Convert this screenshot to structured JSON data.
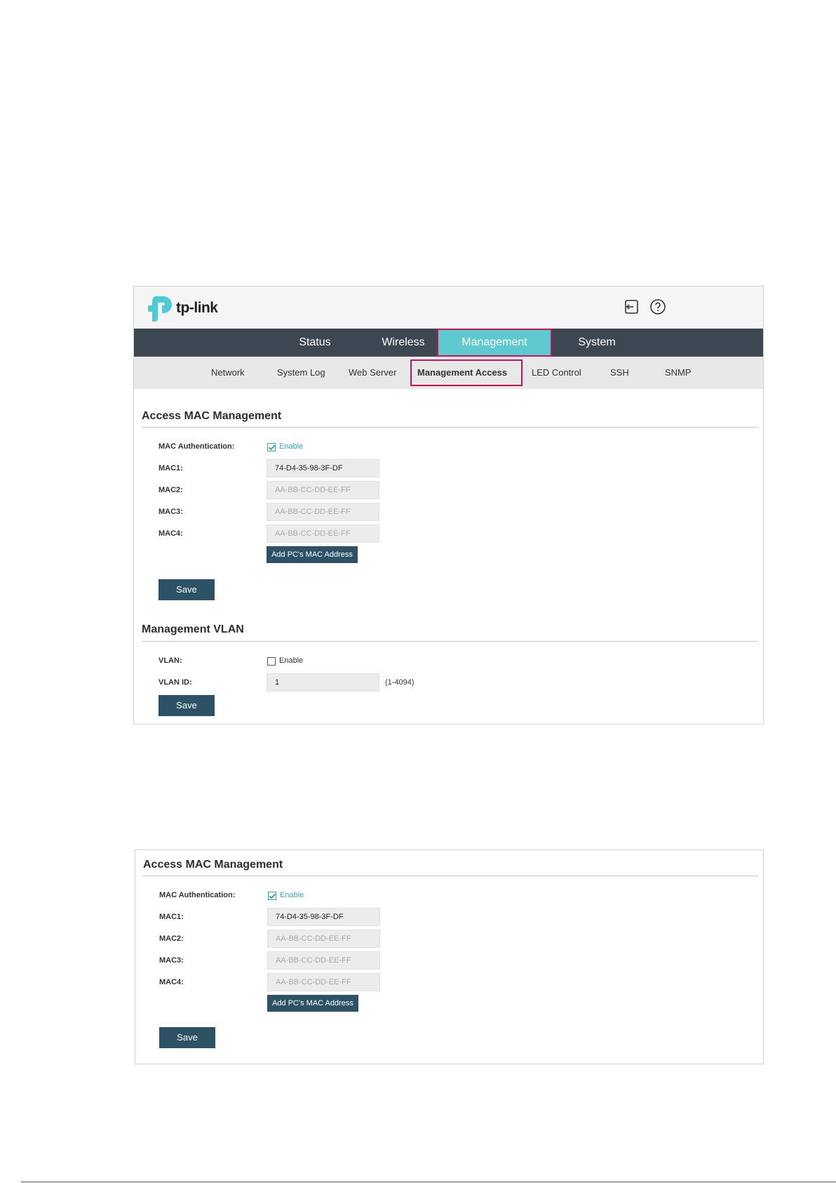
{
  "app": {
    "logo_text": "tp-link",
    "brand_color": "#5ec9cf",
    "header_icons": [
      "logout-icon",
      "help-icon"
    ]
  },
  "main_nav": {
    "tabs": [
      {
        "label": "Status"
      },
      {
        "label": "Wireless"
      },
      {
        "label": "Management"
      },
      {
        "label": "System"
      }
    ],
    "active": "Management"
  },
  "sub_nav": {
    "tabs": [
      {
        "label": "Network"
      },
      {
        "label": "System Log"
      },
      {
        "label": "Web Server"
      },
      {
        "label": "Management Access"
      },
      {
        "label": "LED Control"
      },
      {
        "label": "SSH"
      },
      {
        "label": "SNMP"
      }
    ],
    "active": "Management Access"
  },
  "access_mac": {
    "title": "Access MAC Management",
    "auth_label": "MAC Authentication:",
    "auth_enable_label": "Enable",
    "auth_enabled": true,
    "mac_fields": [
      {
        "label": "MAC1:",
        "value": "74-D4-35-98-3F-DF",
        "placeholder": ""
      },
      {
        "label": "MAC2:",
        "value": "",
        "placeholder": "AA-BB-CC-DD-EE-FF"
      },
      {
        "label": "MAC3:",
        "value": "",
        "placeholder": "AA-BB-CC-DD-EE-FF"
      },
      {
        "label": "MAC4:",
        "value": "",
        "placeholder": "AA-BB-CC-DD-EE-FF"
      }
    ],
    "add_pc_mac_label": "Add PC's MAC Address",
    "save_label": "Save"
  },
  "mgmt_vlan": {
    "title": "Management VLAN",
    "vlan_label": "VLAN:",
    "vlan_enable_label": "Enable",
    "vlan_enabled": false,
    "vlan_id_label": "VLAN ID:",
    "vlan_id_value": "1",
    "vlan_id_hint": "(1-4094)",
    "save_label": "Save"
  },
  "colors": {
    "nav_bg": "#3c4752",
    "active_tab_bg": "#5ec9cf",
    "highlight_border": "#c2185b",
    "button_bg": "#2d5266",
    "check_color": "#3aa8b8"
  }
}
